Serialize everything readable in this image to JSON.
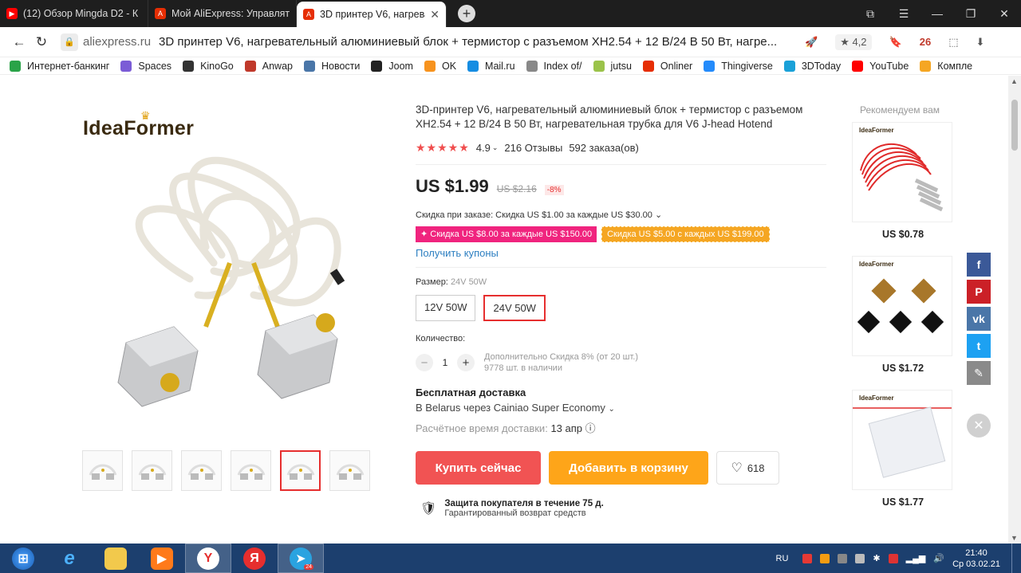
{
  "browser": {
    "tabs": [
      {
        "title": "(12) Обзор Mingda D2 - К",
        "icon": "youtube-icon",
        "color": "#ff0000"
      },
      {
        "title": "Мой AliExpress: Управлять",
        "icon": "aliexpress-icon",
        "color": "#e62e04"
      },
      {
        "title": "3D принтер V6, нагреват",
        "icon": "aliexpress-icon",
        "color": "#e62e04"
      }
    ],
    "new_tab": "+",
    "domain": "aliexpress.ru",
    "page_title": "3D принтер V6, нагревательный алюминиевый блок + термистор с разъемом XH2.54 + 12 В/24 В 50 Вт, нагре...",
    "rating_badge": "4,2",
    "calendar_badge": "26",
    "bookmarks": [
      {
        "label": "Интернет-банкинг",
        "color": "#2aa348"
      },
      {
        "label": "Spaces",
        "color": "#7b5cd6"
      },
      {
        "label": "KinoGo",
        "color": "#333333"
      },
      {
        "label": "Anwap",
        "color": "#c0392b"
      },
      {
        "label": "Новости",
        "color": "#4a76a8"
      },
      {
        "label": "Joom",
        "color": "#222222"
      },
      {
        "label": "OK",
        "color": "#f7931e"
      },
      {
        "label": "Mail.ru",
        "color": "#168de2"
      },
      {
        "label": "Index of/",
        "color": "#888888"
      },
      {
        "label": "jutsu",
        "color": "#9bc34a"
      },
      {
        "label": "Onliner",
        "color": "#e62e04"
      },
      {
        "label": "Thingiverse",
        "color": "#248bfb"
      },
      {
        "label": "3DToday",
        "color": "#1aa1d8"
      },
      {
        "label": "YouTube",
        "color": "#ff0000"
      },
      {
        "label": "Компле",
        "color": "#f5a623"
      }
    ]
  },
  "product": {
    "brand": "IdeaFormer",
    "title": "3D-принтер V6, нагревательный алюминиевый блок + термистор с разъемом XH2.54 + 12 В/24 В 50 Вт, нагревательная трубка для V6 J-head Hotend",
    "rating": "4.9",
    "reviews": "216 Отзывы",
    "orders": "592 заказа(ов)",
    "price_now": "US $1.99",
    "price_old": "US $2.16",
    "discount_pct": "-8%",
    "order_discount": "Скидка при заказе: Скидка US $1.00 за каждые US $30.00",
    "coupon1": "Скидка US $8.00 за каждые US $150.00",
    "coupon2": "Скидка US $5.00 с каждых US $199.00",
    "get_coupons": "Получить купоны",
    "size_label": "Размер:",
    "size_selected": "24V 50W",
    "sizes": [
      "12V 50W",
      "24V 50W"
    ],
    "qty_label": "Количество:",
    "qty": "1",
    "qty_discount": "Дополнительно Скидка 8% (от 20 шт.)",
    "stock": "9778 шт. в наличии",
    "shipping_title": "Бесплатная доставка",
    "shipping_via": "В Belarus через Cainiao Super Economy",
    "eta_label": "Расчётное время доставки:",
    "eta_value": "13 апр",
    "buy_now": "Купить сейчас",
    "add_to_cart": "Добавить в корзину",
    "wishlist_count": "618",
    "protection_title": "Защита покупателя в течение 75 д.",
    "protection_sub": "Гарантированный возврат средств",
    "thumb_selected_index": 4
  },
  "recommend": {
    "heading": "Рекомендуем вам",
    "items": [
      {
        "brand": "IdeaFormer",
        "price": "US $0.78"
      },
      {
        "brand": "IdeaFormer",
        "price": "US $1.72"
      },
      {
        "brand": "IdeaFormer",
        "price": "US $1.77"
      }
    ]
  },
  "social": [
    {
      "name": "facebook",
      "glyph": "f",
      "color": "#3b5998"
    },
    {
      "name": "pinterest",
      "glyph": "P",
      "color": "#cb2027"
    },
    {
      "name": "vk",
      "glyph": "vk",
      "color": "#4a76a8"
    },
    {
      "name": "twitter",
      "glyph": "t",
      "color": "#1da1f2"
    },
    {
      "name": "edit",
      "glyph": "✎",
      "color": "#8a8a8a"
    }
  ],
  "taskbar": {
    "lang": "RU",
    "time": "21:40",
    "date": "Ср 03.02.21",
    "telegram_badge": "24"
  }
}
